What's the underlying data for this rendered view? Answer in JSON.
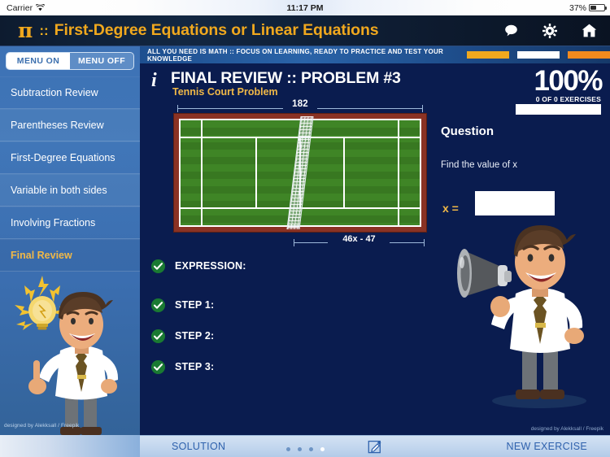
{
  "status_bar": {
    "carrier": "Carrier",
    "wifi_icon": "wifi-icon",
    "time": "11:17 PM",
    "battery_text": "37%",
    "battery_icon": "battery-icon"
  },
  "titlebar": {
    "logo_glyph": "π",
    "separator": "::",
    "title": "First-Degree Equations or Linear Equations",
    "icons": [
      {
        "name": "chat-icon",
        "glyph": "speech-bubble"
      },
      {
        "name": "gear-icon",
        "glyph": "gear"
      },
      {
        "name": "home-icon",
        "glyph": "home"
      }
    ]
  },
  "sidebar": {
    "toggle": {
      "on_label": "MENU ON",
      "off_label": "MENU OFF",
      "selected": "MENU ON"
    },
    "items": [
      {
        "label": "Subtraction Review",
        "active": false
      },
      {
        "label": "Parentheses Review",
        "active": false
      },
      {
        "label": "First-Degree Equations",
        "active": false
      },
      {
        "label": "Variable in both sides",
        "active": false
      },
      {
        "label": "Involving Fractions",
        "active": false
      },
      {
        "label": "Final Review",
        "active": true
      }
    ],
    "credit": "designed by Alekksall / Freepik"
  },
  "ticker": {
    "text": "ALL YOU NEED IS MATH :: FOCUS ON LEARNING, READY TO PRACTICE AND TEST YOUR KNOWLEDGE",
    "bars": [
      "#f0a81e",
      "#ffffff",
      "#f18a1e"
    ]
  },
  "problem": {
    "info_glyph": "i",
    "title": "FINAL REVIEW :: PROBLEM #3",
    "subtitle": "Tennis Court Problem",
    "percent": "100%",
    "exercises": "0 OF 0 EXERCISES"
  },
  "question": {
    "heading": "Question",
    "prompt": "Find the value of x",
    "x_label": "x =",
    "answer_value": "",
    "answer_placeholder": ""
  },
  "diagram": {
    "name": "tennis-court-diagram",
    "top_dimension": "182",
    "bottom_dimension": "46x - 47",
    "court_border_color": "#8a3224",
    "court_surface_color": "#3f8526"
  },
  "steps": [
    {
      "label": "EXPRESSION:",
      "checked": true
    },
    {
      "label": "STEP 1:",
      "checked": true
    },
    {
      "label": "STEP 2:",
      "checked": true
    },
    {
      "label": "STEP 3:",
      "checked": true
    }
  ],
  "toolbar": {
    "solution_label": "SOLUTION",
    "edit_icon": "edit-pencil-icon",
    "new_exercise_label": "NEW EXERCISE"
  },
  "main_credit": "designed by Alekksall / Freepik",
  "page_dots": {
    "count": 4,
    "active_index": 3
  },
  "colors": {
    "accent_gold": "#f0a81e",
    "panel_navy": "#0a1c4f",
    "sidebar_blue": "#3d72b5",
    "check_green": "#1a7a32"
  }
}
